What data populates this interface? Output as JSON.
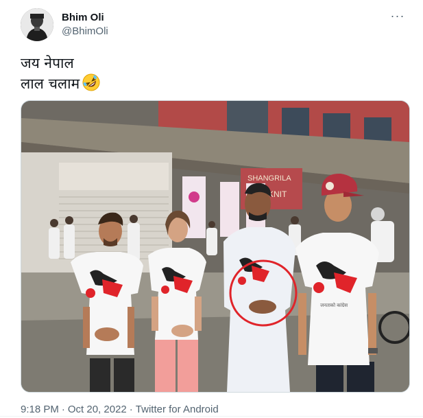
{
  "user": {
    "display_name": "Bhim Oli",
    "handle": "@BhimOli"
  },
  "tweet": {
    "line1": "जय नेपाल",
    "line2": "लाल चलाम",
    "emoji": "rolling-on-floor-laughing-icon"
  },
  "media": {
    "sign_text_shop": "SHANGRILA",
    "sign_text_shop2": "KNIT",
    "shirt_caption": "जनताको कांग्रेस"
  },
  "meta": {
    "time": "9:18 PM",
    "date": "Oct 20, 2022",
    "source": "Twitter for Android"
  },
  "colors": {
    "accent_red": "#e0242a",
    "text_secondary": "#536471"
  }
}
